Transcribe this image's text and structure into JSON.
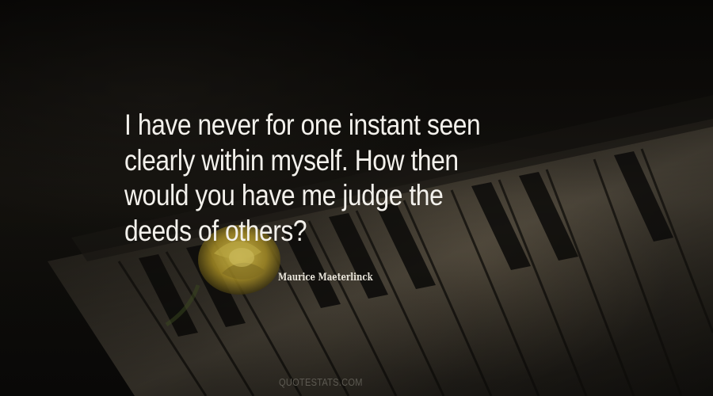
{
  "quote": {
    "lines": [
      "I have never for one instant seen",
      "clearly within myself. How then",
      "would you have me judge the",
      "deeds of others?"
    ]
  },
  "author": "Maurice Maeterlinck",
  "watermark": "QUOTESTATS.COM",
  "background": {
    "subject": "piano keys with a yellow rose",
    "colors": {
      "base": "#0b0a08",
      "keys": "#6f6656",
      "rose": "#c9b23a"
    }
  }
}
